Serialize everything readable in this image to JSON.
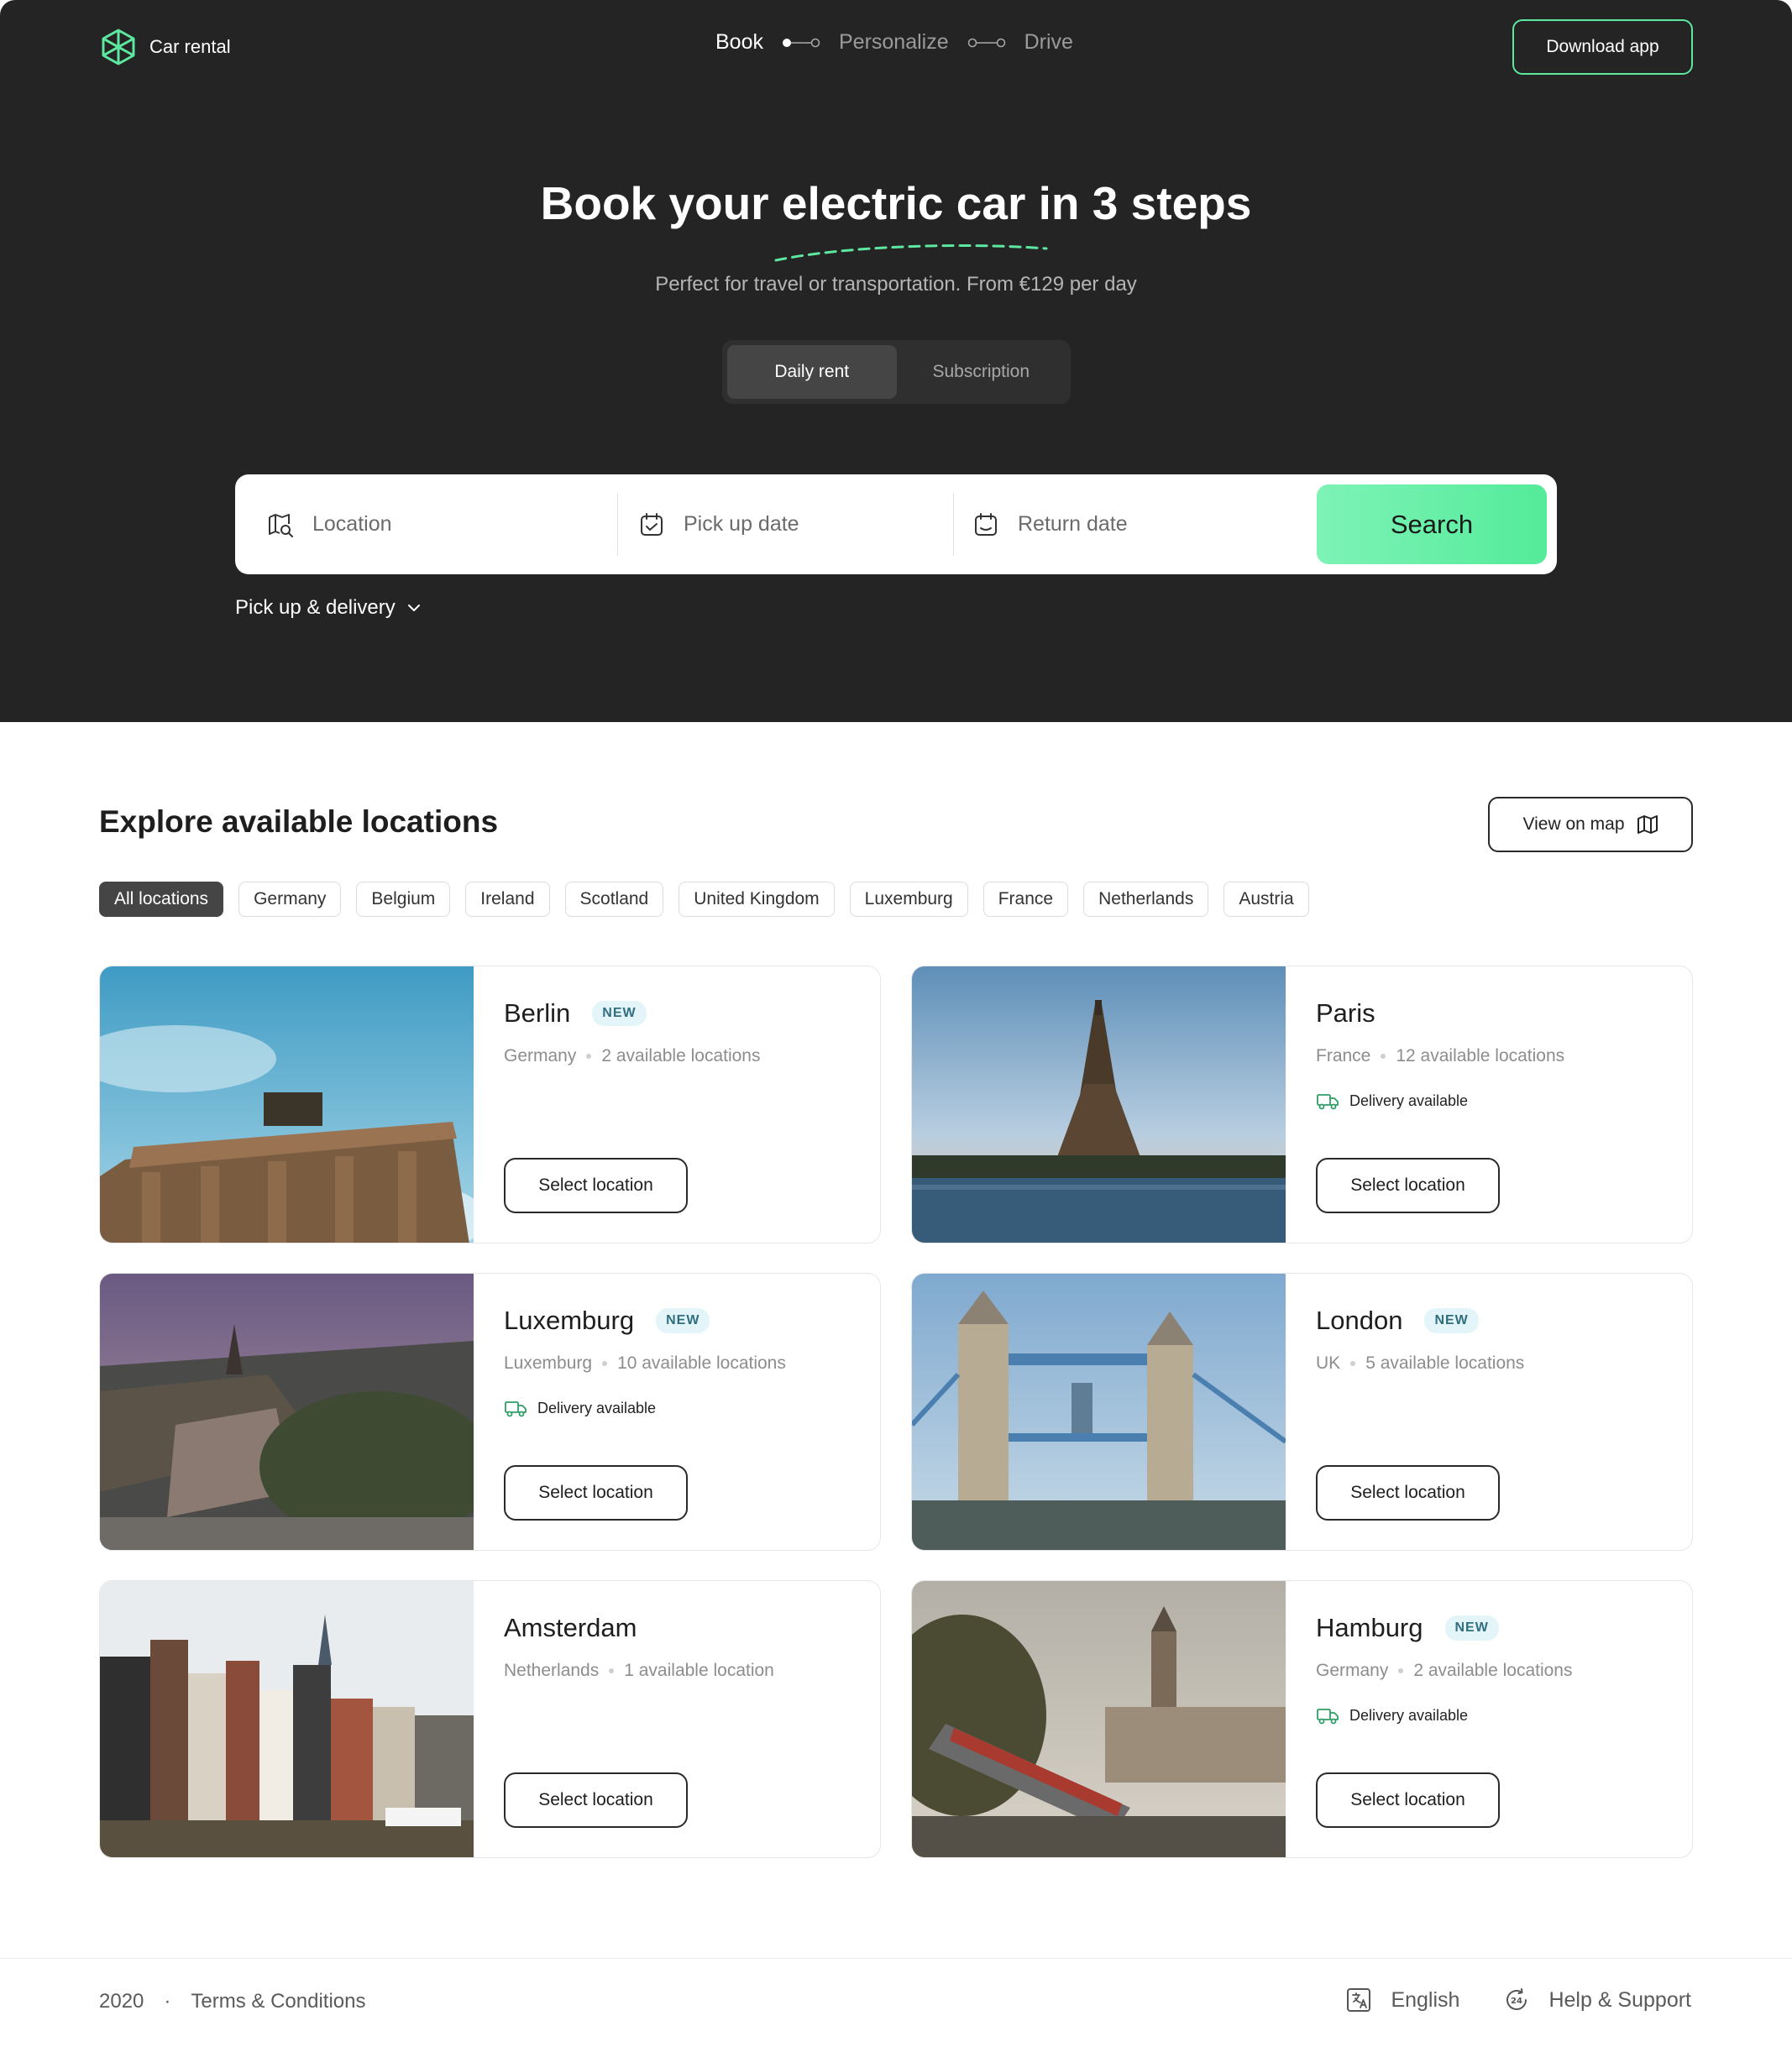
{
  "header": {
    "brand": "Car rental",
    "steps": [
      "Book",
      "Personalize",
      "Drive"
    ],
    "download_label": "Download app"
  },
  "hero": {
    "title": "Book your electric car in 3 steps",
    "subtitle": "Perfect for travel or transportation. From €129 per day",
    "modes": [
      "Daily rent",
      "Subscription"
    ],
    "active_mode": "Daily rent"
  },
  "search": {
    "location_placeholder": "Location",
    "pickup_placeholder": "Pick up date",
    "return_placeholder": "Return date",
    "button_label": "Search",
    "delivery_option": "Pick up & delivery"
  },
  "locations": {
    "title": "Explore available locations",
    "map_button": "View on map",
    "filters": [
      "All locations",
      "Germany",
      "Belgium",
      "Ireland",
      "Scotland",
      "United Kingdom",
      "Luxemburg",
      "France",
      "Netherlands",
      "Austria"
    ],
    "active_filter": "All locations",
    "select_label": "Select location",
    "delivery_label": "Delivery available",
    "cards": [
      {
        "city": "Berlin",
        "badge": "NEW",
        "country": "Germany",
        "count": "2 available locations",
        "delivery": false
      },
      {
        "city": "Paris",
        "badge": "",
        "country": "France",
        "count": "12 available locations",
        "delivery": true
      },
      {
        "city": "Luxemburg",
        "badge": "NEW",
        "country": "Luxemburg",
        "count": "10 available locations",
        "delivery": true
      },
      {
        "city": "London",
        "badge": "NEW",
        "country": "UK",
        "count": "5 available locations",
        "delivery": false
      },
      {
        "city": "Amsterdam",
        "badge": "",
        "country": "Netherlands",
        "count": "1 available location",
        "delivery": false
      },
      {
        "city": "Hamburg",
        "badge": "NEW",
        "country": "Germany",
        "count": "2 available locations",
        "delivery": true
      }
    ]
  },
  "footer": {
    "year": "2020",
    "separator": "·",
    "terms": "Terms & Conditions",
    "language": "English",
    "help": "Help & Support"
  },
  "colors": {
    "accent": "#5de8a0",
    "hero_bg": "#242424",
    "badge_bg": "#e4f5f9"
  }
}
